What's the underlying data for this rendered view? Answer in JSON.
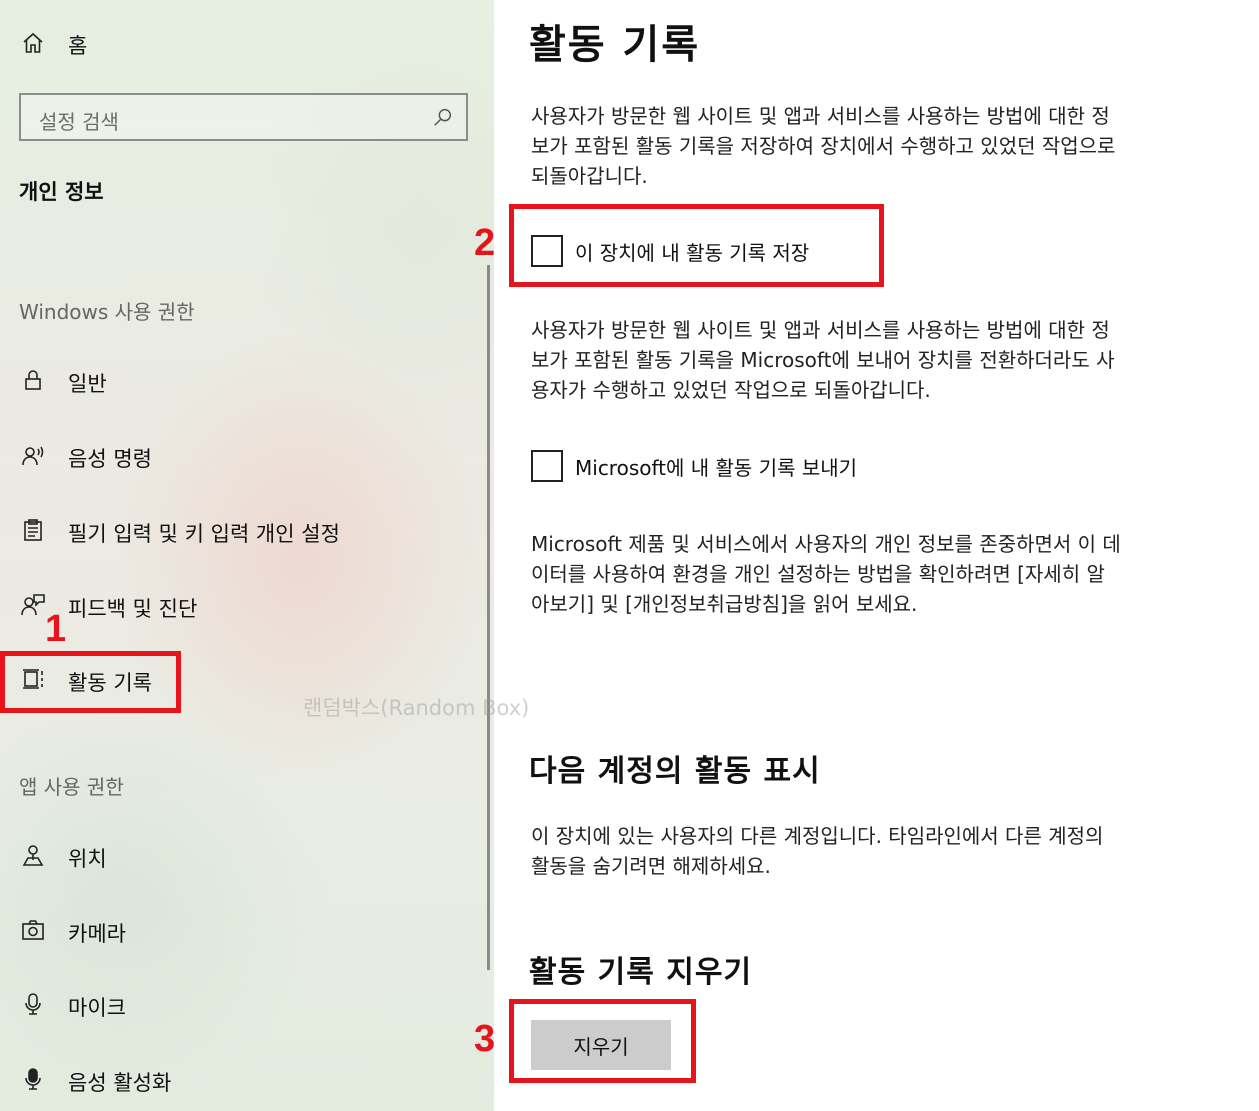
{
  "sidebar": {
    "home_label": "홈",
    "search_placeholder": "설정 검색",
    "section_title": "개인 정보",
    "groups": [
      {
        "header": "Windows 사용 권한",
        "items": [
          {
            "label": "일반",
            "icon": "lock-icon"
          },
          {
            "label": "음성 명령",
            "icon": "voice-person-icon"
          },
          {
            "label": "필기 입력 및 키 입력 개인 설정",
            "icon": "clipboard-icon"
          },
          {
            "label": "피드백 및 진단",
            "icon": "feedback-person-icon"
          },
          {
            "label": "활동 기록",
            "icon": "timeline-icon",
            "selected": true
          }
        ]
      },
      {
        "header": "앱 사용 권한",
        "items": [
          {
            "label": "위치",
            "icon": "location-icon"
          },
          {
            "label": "카메라",
            "icon": "camera-icon"
          },
          {
            "label": "마이크",
            "icon": "microphone-icon"
          },
          {
            "label": "음성 활성화",
            "icon": "voice-activation-icon"
          }
        ]
      }
    ]
  },
  "main": {
    "title": "활동 기록",
    "intro_lines": [
      "사용자가 방문한 웹 사이트 및 앱과 서비스를 사용하는 방법에 대한 정",
      "보가 포함된 활동 기록을 저장하여 장치에서 수행하고 있었던 작업으로",
      "되돌아갑니다."
    ],
    "checkbox_store": {
      "label": "이 장치에 내 활동 기록 저장",
      "checked": false
    },
    "send_lines": [
      "사용자가 방문한 웹 사이트 및 앱과 서비스를 사용하는 방법에 대한 정",
      "보가 포함된 활동 기록을 Microsoft에 보내어 장치를 전환하더라도 사",
      "용자가 수행하고 있었던 작업으로 되돌아갑니다."
    ],
    "checkbox_send": {
      "label": "Microsoft에 내 활동 기록 보내기",
      "checked": false
    },
    "privacy_lines": [
      "Microsoft 제품 및 서비스에서 사용자의 개인 정보를 존중하면서 이 데",
      "이터를 사용하여 환경을 개인 설정하는 방법을 확인하려면 [자세히 알",
      "아보기] 및 [개인정보취급방침]을 읽어 보세요."
    ],
    "accounts_heading": "다음 계정의 활동 표시",
    "accounts_lines": [
      "이 장치에 있는 사용자의 다른 계정입니다. 타임라인에서 다른 계정의",
      "활동을 숨기려면 해제하세요."
    ],
    "clear_heading": "활동 기록 지우기",
    "clear_button": "지우기"
  },
  "watermark": "랜덤박스(Random Box)",
  "annotations": [
    "1",
    "2",
    "3"
  ],
  "colors": {
    "highlight": "#e8141b",
    "button_bg": "#cccccc"
  }
}
